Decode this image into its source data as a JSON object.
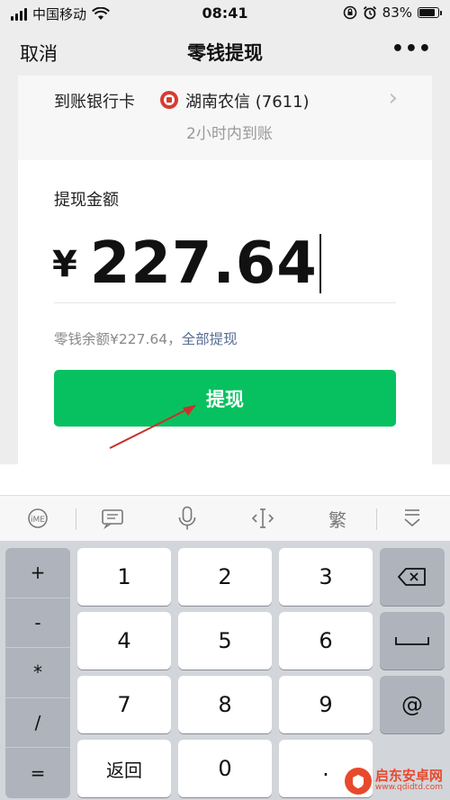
{
  "status_bar": {
    "carrier": "中国移动",
    "time": "08:41",
    "battery": "83%",
    "battery_level": 0.83,
    "icons": [
      "signal-icon",
      "wifi-icon",
      "rotation-lock-icon",
      "alarm-icon",
      "battery-icon"
    ]
  },
  "nav": {
    "cancel": "取消",
    "title": "零钱提现",
    "more": "•••"
  },
  "bank": {
    "label": "到账银行卡",
    "name": "湖南农信 (7611)",
    "arrival": "2小时内到账"
  },
  "withdraw": {
    "label": "提现金额",
    "currency": "¥",
    "amount": "227.64",
    "balance_text": "零钱余额¥227.64，",
    "withdraw_all": "全部提现",
    "button": "提现"
  },
  "toolbar": {
    "traditional": "繁",
    "icons": [
      "input-method-icon",
      "keyboard-switch-icon",
      "microphone-icon",
      "cursor-move-icon",
      "collapse-keyboard-icon"
    ]
  },
  "keyboard": {
    "symbols": [
      "+",
      "-",
      "*",
      "/",
      "="
    ],
    "row1": [
      "1",
      "2",
      "3"
    ],
    "row2": [
      "4",
      "5",
      "6"
    ],
    "row3": [
      "7",
      "8",
      "9"
    ],
    "row4": [
      "返回",
      "0",
      "."
    ],
    "at": "@",
    "fn_icons": [
      "backspace-icon",
      "space-icon"
    ]
  },
  "colors": {
    "accent_green": "#07c160",
    "link_blue": "#576b95",
    "arrow_red": "#c8312a",
    "bank_red": "#d63c2f"
  },
  "watermark": {
    "name": "启东安卓网",
    "url": "www.qdidtd.com"
  }
}
